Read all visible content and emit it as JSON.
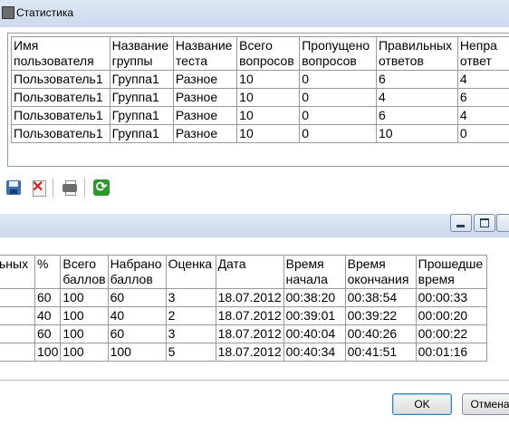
{
  "window": {
    "title": "Статистика"
  },
  "stats_table": {
    "headers": [
      [
        "Имя",
        "пользователя"
      ],
      [
        "Название",
        "группы"
      ],
      [
        "Название",
        "теста"
      ],
      [
        "Всего",
        "вопросов"
      ],
      [
        "Пропущено",
        "вопросов"
      ],
      [
        "Правильных",
        "ответов"
      ],
      [
        "Непра",
        "ответ"
      ]
    ],
    "rows": [
      [
        "Пользователь1",
        "Группа1",
        "Разное",
        "10",
        "0",
        "6",
        "4"
      ],
      [
        "Пользователь1",
        "Группа1",
        "Разное",
        "10",
        "0",
        "4",
        "6"
      ],
      [
        "Пользователь1",
        "Группа1",
        "Разное",
        "10",
        "0",
        "6",
        "4"
      ],
      [
        "Пользователь1",
        "Группа1",
        "Разное",
        "10",
        "0",
        "10",
        "0"
      ]
    ]
  },
  "toolbar": {
    "icons": [
      "save-icon",
      "delete-icon",
      "print-icon",
      "refresh-icon"
    ]
  },
  "results_table": {
    "headers": [
      [
        "ьных",
        ""
      ],
      [
        "%",
        ""
      ],
      [
        "Всего",
        "баллов"
      ],
      [
        "Набрано",
        "баллов"
      ],
      [
        "Оценка",
        ""
      ],
      [
        "Дата",
        ""
      ],
      [
        "Время",
        "начала"
      ],
      [
        "Время",
        "окончания"
      ],
      [
        "Прошедше",
        "время"
      ]
    ],
    "rows": [
      [
        "",
        "60",
        "100",
        "60",
        "3",
        "18.07.2012",
        "00:38:20",
        "00:38:54",
        "00:00:33"
      ],
      [
        "",
        "40",
        "100",
        "40",
        "2",
        "18.07.2012",
        "00:39:01",
        "00:39:22",
        "00:00:20"
      ],
      [
        "",
        "60",
        "100",
        "60",
        "3",
        "18.07.2012",
        "00:40:04",
        "00:40:26",
        "00:00:22"
      ],
      [
        "",
        "100",
        "100",
        "100",
        "5",
        "18.07.2012",
        "00:40:34",
        "00:41:51",
        "00:01:16"
      ]
    ]
  },
  "buttons": {
    "ok": "OK",
    "cancel": "Отмена"
  }
}
